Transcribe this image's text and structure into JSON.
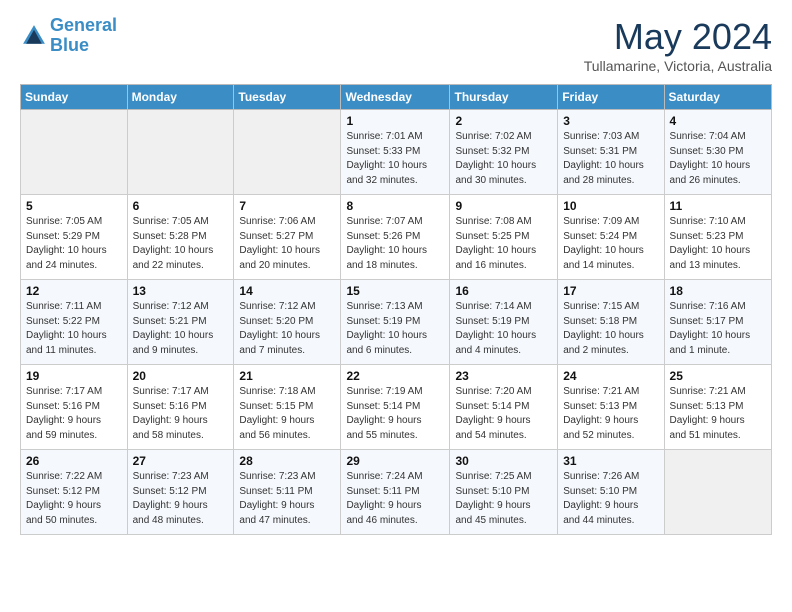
{
  "header": {
    "logo_line1": "General",
    "logo_line2": "Blue",
    "month": "May 2024",
    "location": "Tullamarine, Victoria, Australia"
  },
  "weekdays": [
    "Sunday",
    "Monday",
    "Tuesday",
    "Wednesday",
    "Thursday",
    "Friday",
    "Saturday"
  ],
  "weeks": [
    [
      {
        "day": "",
        "info": ""
      },
      {
        "day": "",
        "info": ""
      },
      {
        "day": "",
        "info": ""
      },
      {
        "day": "1",
        "info": "Sunrise: 7:01 AM\nSunset: 5:33 PM\nDaylight: 10 hours\nand 32 minutes."
      },
      {
        "day": "2",
        "info": "Sunrise: 7:02 AM\nSunset: 5:32 PM\nDaylight: 10 hours\nand 30 minutes."
      },
      {
        "day": "3",
        "info": "Sunrise: 7:03 AM\nSunset: 5:31 PM\nDaylight: 10 hours\nand 28 minutes."
      },
      {
        "day": "4",
        "info": "Sunrise: 7:04 AM\nSunset: 5:30 PM\nDaylight: 10 hours\nand 26 minutes."
      }
    ],
    [
      {
        "day": "5",
        "info": "Sunrise: 7:05 AM\nSunset: 5:29 PM\nDaylight: 10 hours\nand 24 minutes."
      },
      {
        "day": "6",
        "info": "Sunrise: 7:05 AM\nSunset: 5:28 PM\nDaylight: 10 hours\nand 22 minutes."
      },
      {
        "day": "7",
        "info": "Sunrise: 7:06 AM\nSunset: 5:27 PM\nDaylight: 10 hours\nand 20 minutes."
      },
      {
        "day": "8",
        "info": "Sunrise: 7:07 AM\nSunset: 5:26 PM\nDaylight: 10 hours\nand 18 minutes."
      },
      {
        "day": "9",
        "info": "Sunrise: 7:08 AM\nSunset: 5:25 PM\nDaylight: 10 hours\nand 16 minutes."
      },
      {
        "day": "10",
        "info": "Sunrise: 7:09 AM\nSunset: 5:24 PM\nDaylight: 10 hours\nand 14 minutes."
      },
      {
        "day": "11",
        "info": "Sunrise: 7:10 AM\nSunset: 5:23 PM\nDaylight: 10 hours\nand 13 minutes."
      }
    ],
    [
      {
        "day": "12",
        "info": "Sunrise: 7:11 AM\nSunset: 5:22 PM\nDaylight: 10 hours\nand 11 minutes."
      },
      {
        "day": "13",
        "info": "Sunrise: 7:12 AM\nSunset: 5:21 PM\nDaylight: 10 hours\nand 9 minutes."
      },
      {
        "day": "14",
        "info": "Sunrise: 7:12 AM\nSunset: 5:20 PM\nDaylight: 10 hours\nand 7 minutes."
      },
      {
        "day": "15",
        "info": "Sunrise: 7:13 AM\nSunset: 5:19 PM\nDaylight: 10 hours\nand 6 minutes."
      },
      {
        "day": "16",
        "info": "Sunrise: 7:14 AM\nSunset: 5:19 PM\nDaylight: 10 hours\nand 4 minutes."
      },
      {
        "day": "17",
        "info": "Sunrise: 7:15 AM\nSunset: 5:18 PM\nDaylight: 10 hours\nand 2 minutes."
      },
      {
        "day": "18",
        "info": "Sunrise: 7:16 AM\nSunset: 5:17 PM\nDaylight: 10 hours\nand 1 minute."
      }
    ],
    [
      {
        "day": "19",
        "info": "Sunrise: 7:17 AM\nSunset: 5:16 PM\nDaylight: 9 hours\nand 59 minutes."
      },
      {
        "day": "20",
        "info": "Sunrise: 7:17 AM\nSunset: 5:16 PM\nDaylight: 9 hours\nand 58 minutes."
      },
      {
        "day": "21",
        "info": "Sunrise: 7:18 AM\nSunset: 5:15 PM\nDaylight: 9 hours\nand 56 minutes."
      },
      {
        "day": "22",
        "info": "Sunrise: 7:19 AM\nSunset: 5:14 PM\nDaylight: 9 hours\nand 55 minutes."
      },
      {
        "day": "23",
        "info": "Sunrise: 7:20 AM\nSunset: 5:14 PM\nDaylight: 9 hours\nand 54 minutes."
      },
      {
        "day": "24",
        "info": "Sunrise: 7:21 AM\nSunset: 5:13 PM\nDaylight: 9 hours\nand 52 minutes."
      },
      {
        "day": "25",
        "info": "Sunrise: 7:21 AM\nSunset: 5:13 PM\nDaylight: 9 hours\nand 51 minutes."
      }
    ],
    [
      {
        "day": "26",
        "info": "Sunrise: 7:22 AM\nSunset: 5:12 PM\nDaylight: 9 hours\nand 50 minutes."
      },
      {
        "day": "27",
        "info": "Sunrise: 7:23 AM\nSunset: 5:12 PM\nDaylight: 9 hours\nand 48 minutes."
      },
      {
        "day": "28",
        "info": "Sunrise: 7:23 AM\nSunset: 5:11 PM\nDaylight: 9 hours\nand 47 minutes."
      },
      {
        "day": "29",
        "info": "Sunrise: 7:24 AM\nSunset: 5:11 PM\nDaylight: 9 hours\nand 46 minutes."
      },
      {
        "day": "30",
        "info": "Sunrise: 7:25 AM\nSunset: 5:10 PM\nDaylight: 9 hours\nand 45 minutes."
      },
      {
        "day": "31",
        "info": "Sunrise: 7:26 AM\nSunset: 5:10 PM\nDaylight: 9 hours\nand 44 minutes."
      },
      {
        "day": "",
        "info": ""
      }
    ]
  ]
}
